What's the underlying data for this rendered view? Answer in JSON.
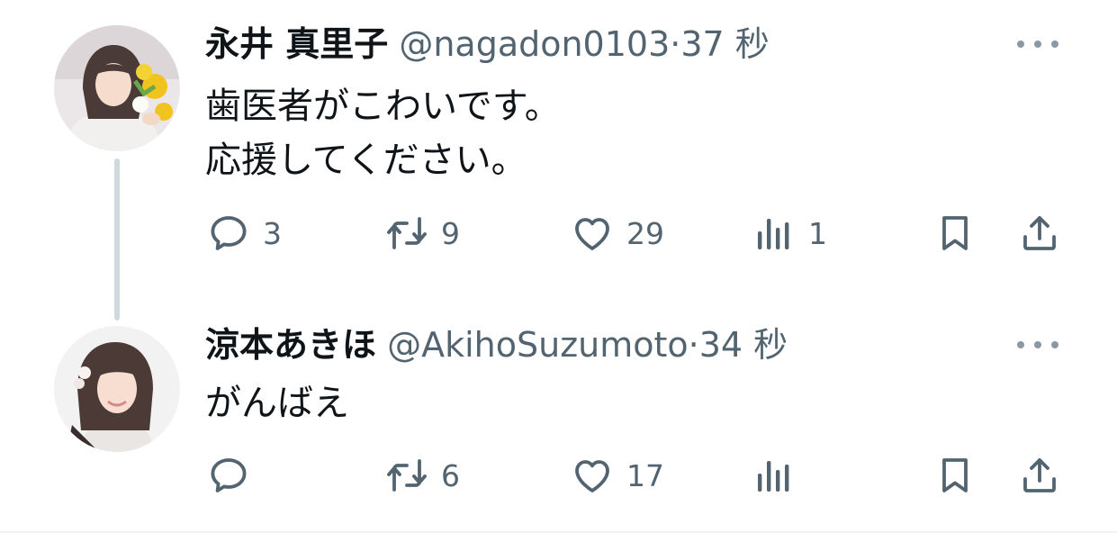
{
  "tweets": [
    {
      "name": "永井 真里子",
      "handle": "@nagadon0103",
      "separator": "·",
      "time": "37 秒",
      "lines": [
        "歯医者がこわいです。",
        "応援してください。"
      ],
      "replies": "3",
      "retweets": "9",
      "likes": "29",
      "views": "1"
    },
    {
      "name": "涼本あきほ",
      "handle": "@AkihoSuzumoto",
      "separator": "·",
      "time": "34 秒",
      "lines": [
        "がんばえ"
      ],
      "replies": "",
      "retweets": "6",
      "likes": "17",
      "views": ""
    }
  ],
  "icons": {
    "reply": "reply-icon",
    "retweet": "retweet-icon",
    "like": "heart-icon",
    "views": "views-icon",
    "bookmark": "bookmark-icon",
    "share": "share-icon",
    "more": "more-icon"
  },
  "colors": {
    "text": "#0f1419",
    "secondary": "#536471",
    "thread_line": "#cfd9de"
  }
}
